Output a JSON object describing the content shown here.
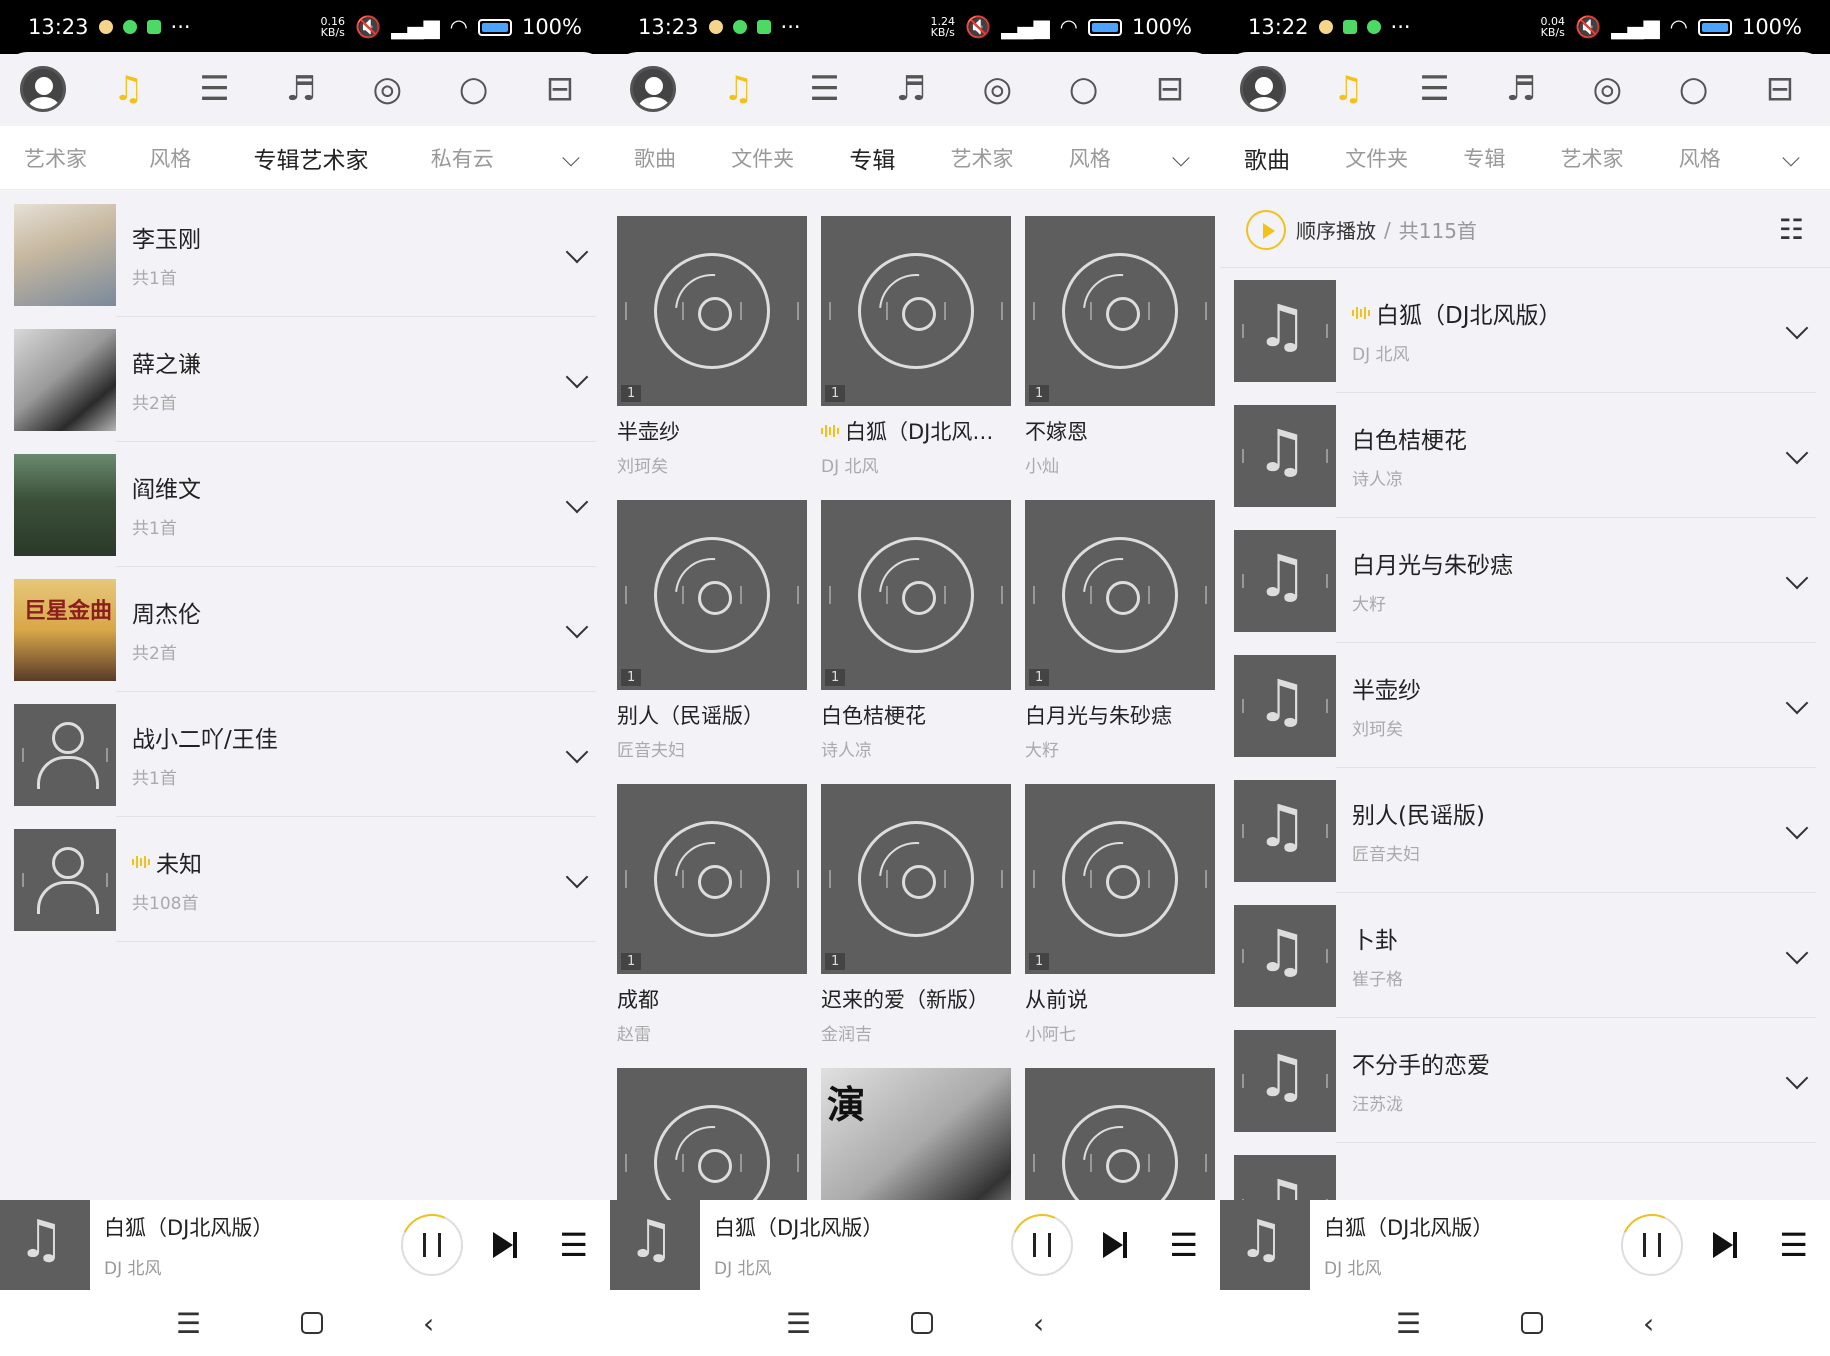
{
  "status": [
    {
      "time": "13:23",
      "net": "0.16\nKB/s",
      "battery": "100%"
    },
    {
      "time": "13:23",
      "net": "1.24\nKB/s",
      "battery": "100%"
    },
    {
      "time": "13:22",
      "net": "0.04\nKB/s",
      "battery": "100%"
    }
  ],
  "colors": {
    "accent": "#f2c21b",
    "placeholder": "#5e5e5e",
    "bg": "#f3f2f7"
  },
  "toolbar_icons": [
    "avatar-icon",
    "music-note-icon",
    "playlist-icon",
    "hr-music-icon",
    "radio-icon",
    "search-icon",
    "scan-icon"
  ],
  "panel1": {
    "tabs": [
      "艺术家",
      "风格",
      "专辑艺术家",
      "私有云"
    ],
    "active_tab": "专辑艺术家",
    "artists": [
      {
        "name": "李玉刚",
        "count": "共1首"
      },
      {
        "name": "薛之谦",
        "count": "共2首"
      },
      {
        "name": "阎维文",
        "count": "共1首"
      },
      {
        "name": "周杰伦",
        "count": "共2首",
        "cover_text": "巨星金曲"
      },
      {
        "name": "战小二吖/王佳",
        "count": "共1首"
      },
      {
        "name": "未知",
        "count": "共108首"
      }
    ]
  },
  "panel2": {
    "tabs": [
      "歌曲",
      "文件夹",
      "专辑",
      "艺术家",
      "风格"
    ],
    "active_tab": "专辑",
    "albums": [
      {
        "title": "半壶纱",
        "artist": "刘珂矣",
        "count": "1"
      },
      {
        "title": "白狐（DJ北风版）",
        "artist": "DJ 北风",
        "count": "1",
        "playing": true
      },
      {
        "title": "不嫁恩",
        "artist": "小灿",
        "count": "1"
      },
      {
        "title": "别人（民谣版）",
        "artist": "匠音夫妇",
        "count": "1"
      },
      {
        "title": "白色桔梗花",
        "artist": "诗人凉",
        "count": "1"
      },
      {
        "title": "白月光与朱砂痣",
        "artist": "大籽",
        "count": "1"
      },
      {
        "title": "成都",
        "artist": "赵雷",
        "count": "1"
      },
      {
        "title": "迟来的爱（新版）",
        "artist": "金润吉",
        "count": "1"
      },
      {
        "title": "从前说",
        "artist": "小阿七",
        "count": "1"
      },
      {
        "title": "",
        "artist": "",
        "count": ""
      },
      {
        "title": "",
        "artist": "",
        "count": "",
        "cover_text": "演"
      },
      {
        "title": "",
        "artist": "",
        "count": ""
      }
    ]
  },
  "panel3": {
    "tabs": [
      "歌曲",
      "文件夹",
      "专辑",
      "艺术家",
      "风格"
    ],
    "active_tab": "歌曲",
    "play_all_label": "顺序播放",
    "play_all_sep": "/",
    "play_all_count": "共115首",
    "songs": [
      {
        "title": "白狐（DJ北风版）",
        "artist": "DJ 北风",
        "playing": true
      },
      {
        "title": "白色桔梗花",
        "artist": "诗人凉"
      },
      {
        "title": "白月光与朱砂痣",
        "artist": "大籽"
      },
      {
        "title": "半壶纱",
        "artist": "刘珂矣"
      },
      {
        "title": "别人(民谣版)",
        "artist": "匠音夫妇"
      },
      {
        "title": "卜卦",
        "artist": "崔子格"
      },
      {
        "title": "不分手的恋爱",
        "artist": "汪苏泷"
      }
    ]
  },
  "player": {
    "title": "白狐（DJ北风版）",
    "artist": "DJ 北风"
  }
}
